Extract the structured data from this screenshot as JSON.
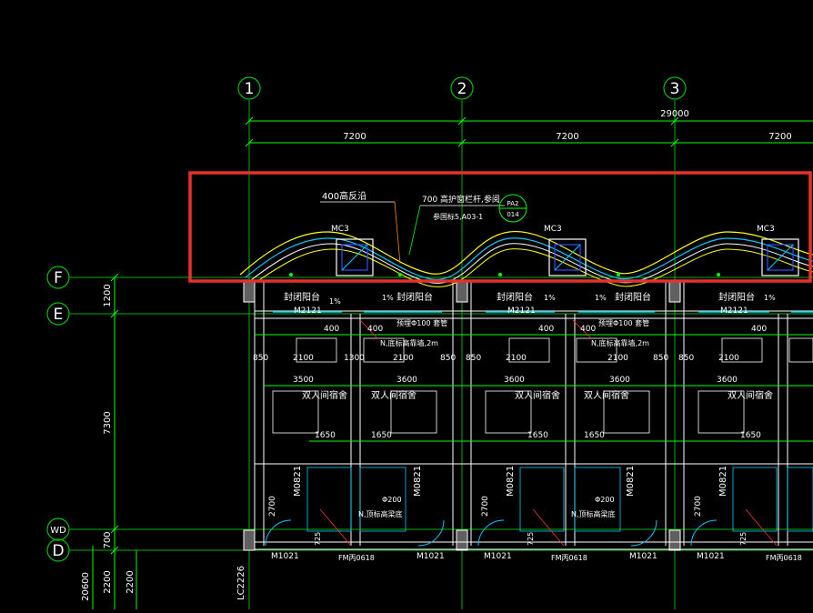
{
  "grid_axes": {
    "vertical": [
      "1",
      "2",
      "3"
    ],
    "horizontal": [
      "F",
      "E",
      "WD",
      "D"
    ]
  },
  "dimensions": {
    "overall": "29000",
    "bays": [
      "7200",
      "7200",
      "7200"
    ],
    "vertical": [
      "1200",
      "7300",
      "700",
      "2200",
      "2200",
      "20600"
    ],
    "bay_detail_top": [
      "850",
      "2100",
      "1300",
      "2100",
      "850"
    ],
    "bay_detail_600": "400",
    "rooms": [
      "3500",
      "3600",
      "3600",
      "3600",
      "3600"
    ],
    "sub": [
      "1650",
      "1650"
    ],
    "door_height": "2700",
    "small": [
      "725",
      "200"
    ]
  },
  "annotations": {
    "parapet": "400高反沿",
    "rail_note": "700 高护窗栏杆,参阅",
    "rail_ref": "参国标5,A03-1",
    "callout_top": "PA2",
    "callout_bottom": "014",
    "closed_balcony": "封闭阳台",
    "slope": "1%",
    "pipe": "预埋Φ100 套管",
    "wall_note": "N,底标高靠墙,2m",
    "dorm": "双人间宿舍",
    "floor_drain": "Φ200",
    "roof_note": "N,顶标高梁底",
    "column_tag": "LC2226"
  },
  "door_tags": {
    "mc": "MC3",
    "m2121": "M2121",
    "m1021": "M1021",
    "m0821": "M0821",
    "fm": "FM丙0618"
  },
  "highlight_box": {
    "color": "#e8312c"
  },
  "colors": {
    "grid": "#00c000",
    "wall": "#ffffff",
    "dim": "#00ff00",
    "text": "#ffffff",
    "yellow": "#ffff00",
    "cyan": "#00c8ff",
    "blue": "#3050ff",
    "red": "#ff3030"
  }
}
